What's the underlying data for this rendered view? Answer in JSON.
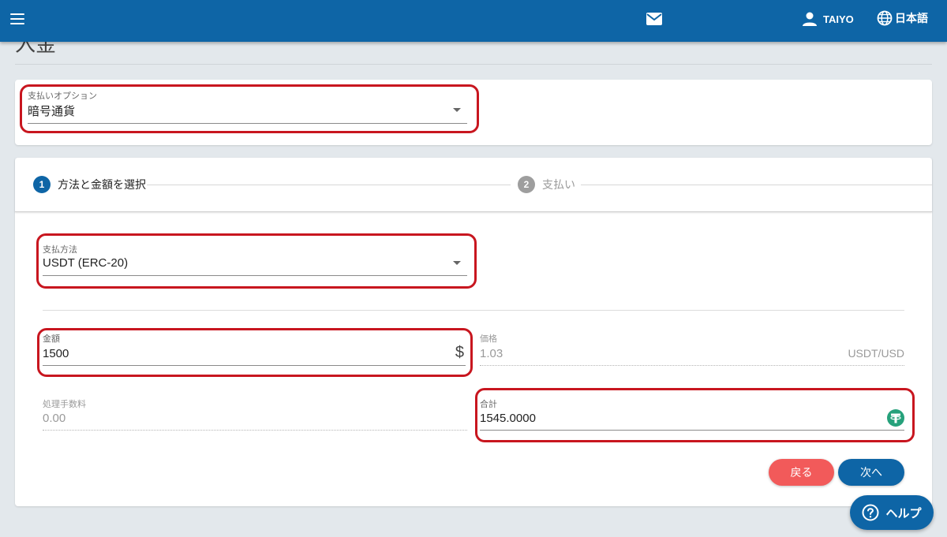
{
  "header": {
    "user_name": "TAIYO",
    "language_label": "日本語",
    "icons": [
      "menu-icon",
      "mail-icon",
      "person-icon",
      "globe-icon"
    ]
  },
  "page": {
    "title": "入金"
  },
  "payment_option": {
    "label": "支払いオプション",
    "value": "暗号通貨"
  },
  "stepper": {
    "steps": [
      {
        "number": "1",
        "label": "方法と金額を選択",
        "active": true
      },
      {
        "number": "2",
        "label": "支払い",
        "active": false
      }
    ]
  },
  "form": {
    "method": {
      "label": "支払方法",
      "value": "USDT (ERC-20)"
    },
    "amount": {
      "label": "金額",
      "value": "1500",
      "suffix": "$"
    },
    "rate": {
      "label": "価格",
      "value": "1.03",
      "unit": "USDT/USD"
    },
    "fee": {
      "label": "処理手数料",
      "value": "0.00"
    },
    "total": {
      "label": "合計",
      "value": "1545.0000",
      "icon": "tether-icon"
    }
  },
  "buttons": {
    "back_label": "戻る",
    "next_label": "次へ",
    "help_label": "ヘルプ"
  },
  "colors": {
    "primary": "#0e65a6",
    "back_button": "#f25a5a",
    "highlight": "#c8161f",
    "tether": "#26a17b"
  }
}
